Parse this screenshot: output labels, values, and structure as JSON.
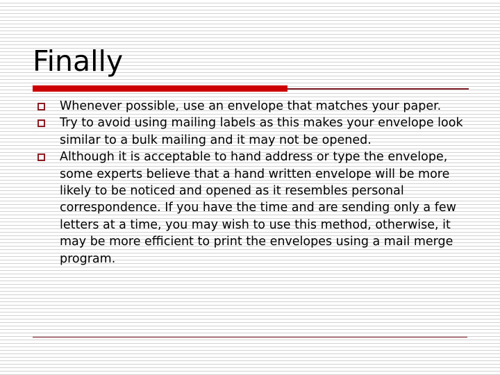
{
  "slide": {
    "title": "Finally",
    "bullet_marker_icon": "hollow-square-bullet-icon",
    "bullets": [
      {
        "text": "Whenever possible, use an envelope that matches your paper."
      },
      {
        "text": "Try to avoid using mailing labels as this makes your envelope look similar to a bulk mailing and it may not be opened."
      },
      {
        "text": "Although it is acceptable to hand address or type the envelope, some experts believe that a hand written envelope will be more likely to be noticed and opened as it resembles personal correspondence. If you have the time and are sending only a few letters at a time, you may wish to use this method, otherwise, it may be more efficient to print the envelopes using a mail merge program."
      }
    ]
  },
  "colors": {
    "title_text": "#000000",
    "body_text": "#000000",
    "accent_bar_thick": "#cc0000",
    "accent_rule_thin": "#7e1c26",
    "bullet_marker": "#8c1c22",
    "background": "#ffffff",
    "background_stripe": "#d2d2d2"
  }
}
